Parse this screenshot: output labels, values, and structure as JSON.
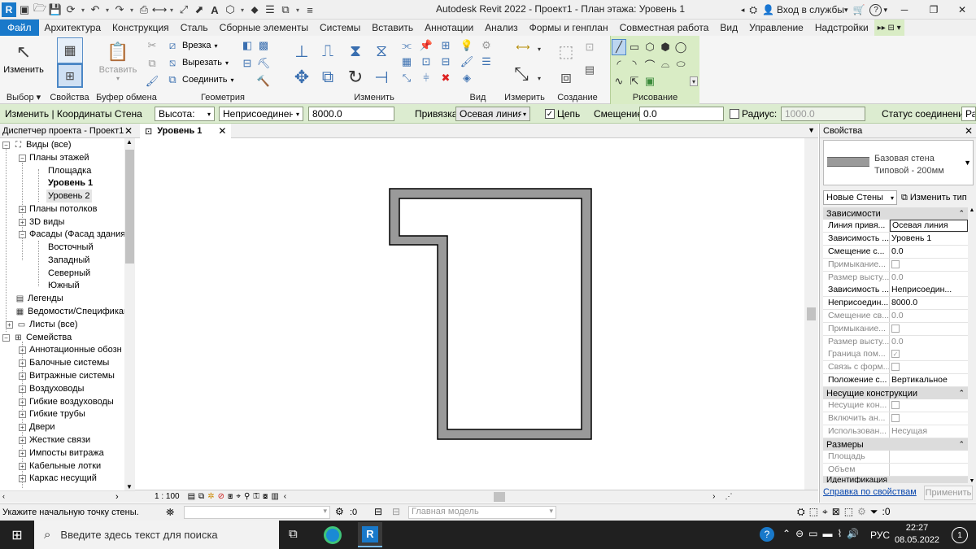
{
  "titlebar": {
    "title": "Autodesk Revit 2022 - Проект1 - План этажа: Уровень 1",
    "signin": "Вход в службы",
    "signin_caret": "▾",
    "help_caret": "▾"
  },
  "tabs": [
    "Файл",
    "Архитектура",
    "Конструкция",
    "Сталь",
    "Сборные элементы",
    "Системы",
    "Вставить",
    "Аннотации",
    "Анализ",
    "Формы и генплан",
    "Совместная работа",
    "Вид",
    "Управление",
    "Надстройки"
  ],
  "ribbon": {
    "select": {
      "modify": "Изменить",
      "label": "Выбор"
    },
    "props": {
      "label": "Свойства"
    },
    "clipboard": {
      "paste": "Вставить",
      "label": "Буфер обмена"
    },
    "geometry": {
      "cut": "Врезка",
      "uncut": "Вырезать",
      "join": "Соединить",
      "label": "Геометрия"
    },
    "modify": {
      "label": "Изменить"
    },
    "view": {
      "label": "Вид"
    },
    "measure": {
      "label": "Измерить"
    },
    "create": {
      "label": "Создание"
    },
    "draw": {
      "label": "Рисование"
    }
  },
  "options": {
    "context": "Изменить | Координаты Стена",
    "height_label": "Высота:",
    "height_value": "Неприсоединенн",
    "height_num": "8000.0",
    "snap_label": "Привязка:",
    "snap_value": "Осевая линия с",
    "chain_label": "Цепь",
    "offset_label": "Смещение:",
    "offset_value": "0.0",
    "radius_label": "Радиус:",
    "radius_value": "1000.0",
    "join_status": "Статус соединения:",
    "join_cut": "Раз"
  },
  "browser": {
    "title": "Диспетчер проекта - Проект1",
    "items": [
      {
        "label": "Виды (все)",
        "bold": false
      },
      {
        "label": "Планы этажей",
        "bold": false
      },
      {
        "label": "Площадка",
        "bold": false
      },
      {
        "label": "Уровень 1",
        "bold": true
      },
      {
        "label": "Уровень 2",
        "bold": false
      },
      {
        "label": "Планы потолков",
        "bold": false
      },
      {
        "label": "3D виды",
        "bold": false
      },
      {
        "label": "Фасады (Фасад здания",
        "bold": false
      },
      {
        "label": "Восточный",
        "bold": false
      },
      {
        "label": "Западный",
        "bold": false
      },
      {
        "label": "Северный",
        "bold": false
      },
      {
        "label": "Южный",
        "bold": false
      },
      {
        "label": "Легенды",
        "bold": false
      },
      {
        "label": "Ведомости/Спецификац",
        "bold": false
      },
      {
        "label": "Листы (все)",
        "bold": false
      },
      {
        "label": "Семейства",
        "bold": false
      },
      {
        "label": "Аннотационные обозн",
        "bold": false
      },
      {
        "label": "Балочные системы",
        "bold": false
      },
      {
        "label": "Витражные системы",
        "bold": false
      },
      {
        "label": "Воздуховоды",
        "bold": false
      },
      {
        "label": "Гибкие воздуховоды",
        "bold": false
      },
      {
        "label": "Гибкие трубы",
        "bold": false
      },
      {
        "label": "Двери",
        "bold": false
      },
      {
        "label": "Жесткие связи",
        "bold": false
      },
      {
        "label": "Импосты витража",
        "bold": false
      },
      {
        "label": "Кабельные лотки",
        "bold": false
      },
      {
        "label": "Каркас несущий",
        "bold": false
      }
    ]
  },
  "view": {
    "tab_label": "Уровень 1",
    "scale": "1 : 100"
  },
  "properties": {
    "title": "Свойства",
    "type_name": "Базовая стена",
    "type_sub": "Типовой - 200мм",
    "instance_select": "Новые Стены",
    "edit_type": "Изменить тип",
    "groups": {
      "constraints": "Зависимости",
      "structural": "Несущие конструкции",
      "dimensions": "Размеры",
      "identity": "Идентификация"
    },
    "rows": [
      {
        "name": "Линия привя...",
        "value": "Осевая линия"
      },
      {
        "name": "Зависимость ...",
        "value": "Уровень 1"
      },
      {
        "name": "Смещение с...",
        "value": "0.0"
      },
      {
        "name": "Примыкание...",
        "value": ""
      },
      {
        "name": "Размер высту...",
        "value": "0.0"
      },
      {
        "name": "Зависимость ...",
        "value": "Неприсоедин..."
      },
      {
        "name": "Неприсоедин...",
        "value": "8000.0"
      },
      {
        "name": "Смещение св...",
        "value": "0.0"
      },
      {
        "name": "Примыкание...",
        "value": ""
      },
      {
        "name": "Размер высту...",
        "value": "0.0"
      },
      {
        "name": "Граница пом...",
        "value": ""
      },
      {
        "name": "Связь с форм...",
        "value": ""
      },
      {
        "name": "Положение с...",
        "value": "Вертикальное"
      },
      {
        "name": "Несущие кон...",
        "value": ""
      },
      {
        "name": "Включить ан...",
        "value": ""
      },
      {
        "name": "Использован...",
        "value": "Несущая"
      },
      {
        "name": "Площадь",
        "value": ""
      },
      {
        "name": "Объем",
        "value": ""
      }
    ],
    "help_link": "Справка по свойствам",
    "apply": "Применить"
  },
  "status": {
    "prompt": "Укажите начальную точку стены.",
    "zero": ":0",
    "model": "Главная модель",
    "filter_count": ":0"
  },
  "taskbar": {
    "search": "Введите здесь текст для поиска",
    "lang": "РУС",
    "time": "22:27",
    "date": "08.05.2022",
    "notif": "1"
  }
}
